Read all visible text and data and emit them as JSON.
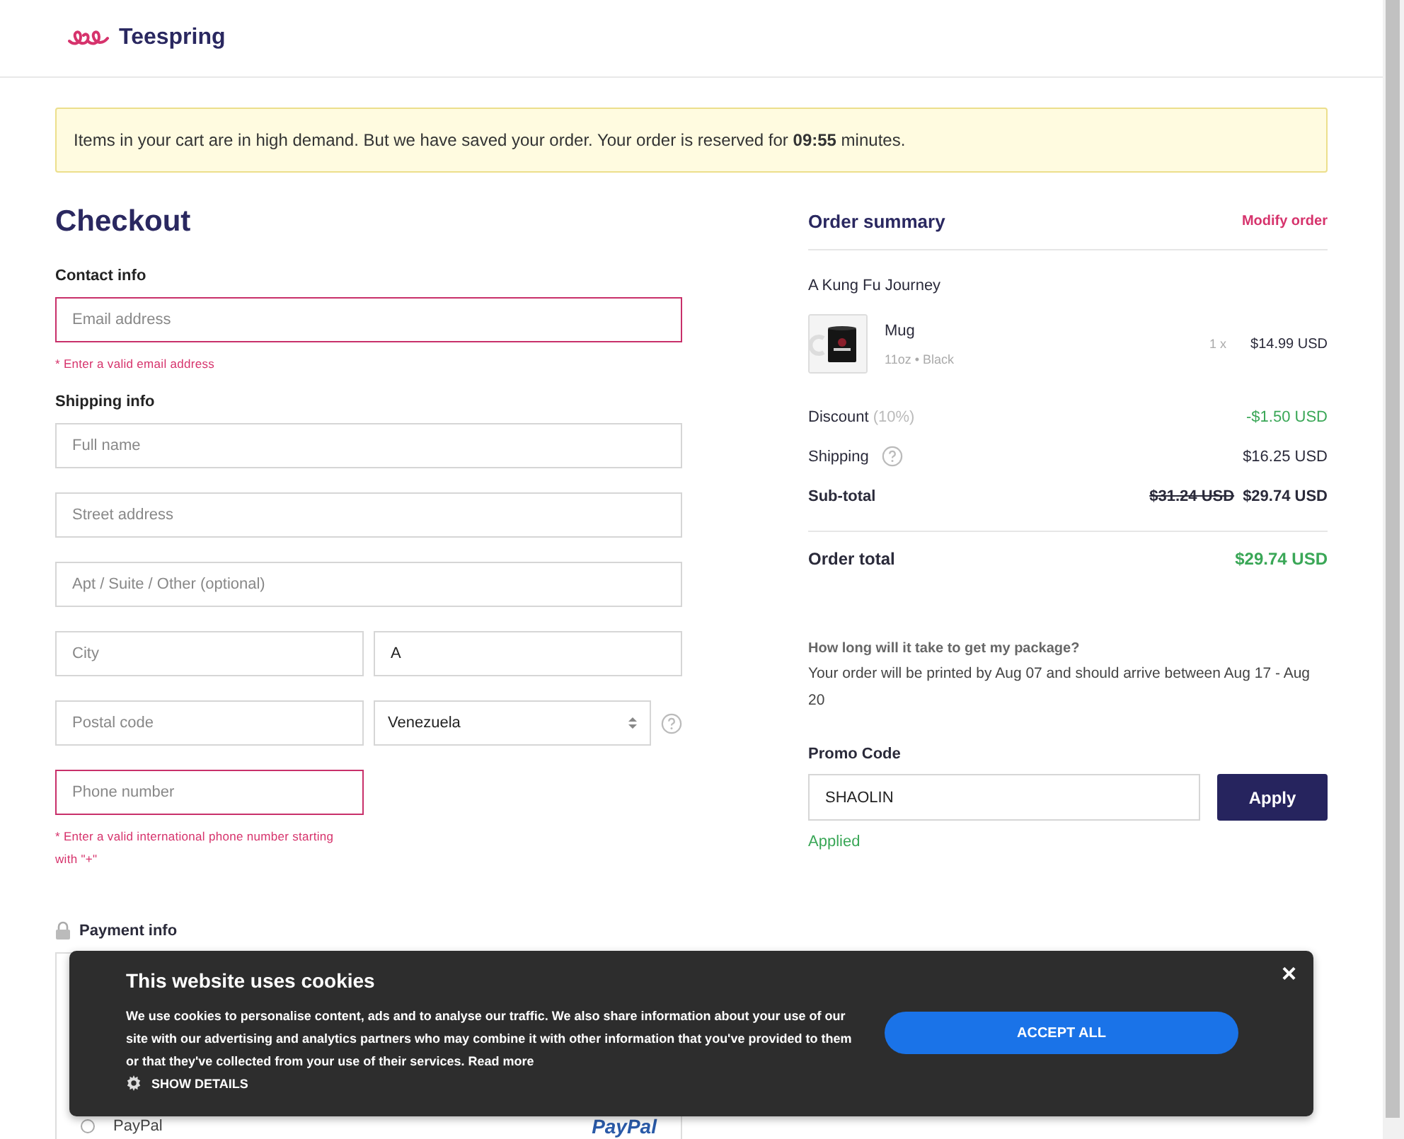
{
  "header": {
    "brand": "Teespring"
  },
  "notice": {
    "text": "Items in your cart are in high demand. But we have saved your order. Your order is reserved for **09:55** minutes."
  },
  "checkout": {
    "title": "Checkout",
    "sections": [
      {
        "heading": "Contact info",
        "rows": [
          [
            {
              "kind": "input",
              "placeholder": "Email address",
              "wide": true,
              "invalid": true,
              "error": "* Enter a valid email address"
            }
          ]
        ]
      },
      {
        "heading": "Shipping info",
        "rows": [
          [
            {
              "kind": "input",
              "placeholder": "Full name",
              "wide": true,
              "invalid": false
            }
          ],
          [
            {
              "kind": "input",
              "placeholder": "Street address",
              "wide": true,
              "invalid": false
            }
          ],
          [
            {
              "kind": "input",
              "placeholder": "Apt / Suite / Other (optional)",
              "wide": true,
              "invalid": false
            }
          ],
          [
            {
              "kind": "input",
              "placeholder": "City",
              "wide": false,
              "invalid": false
            },
            {
              "kind": "input",
              "value": "A",
              "wide": false,
              "invalid": false
            }
          ],
          [
            {
              "kind": "input",
              "placeholder": "Postal code",
              "wide": false,
              "invalid": false
            },
            {
              "kind": "select",
              "value": "Venezuela",
              "wide": false,
              "invalid": false,
              "help": true
            }
          ],
          [
            {
              "kind": "input",
              "placeholder": "Phone number",
              "wide": false,
              "invalid": true,
              "error": "* Enter a valid international phone number starting with \"+\""
            }
          ]
        ]
      }
    ]
  },
  "payment": {
    "heading": "Payment info",
    "options": [
      {
        "label": "PayPal",
        "logo": "PayPal",
        "selected": false
      }
    ]
  },
  "summary": {
    "title": "Order summary",
    "modify_link": "Modify order",
    "store": "A Kung Fu Journey",
    "item": {
      "kind": "picture",
      "name": "Mug",
      "variant": "11oz • Black",
      "quantity": "1 x",
      "price": "$14.99 USD"
    },
    "lines": [
      {
        "kind": "discount",
        "label": "Discount",
        "help": false,
        "note": "(10%)",
        "value": "-$1.50 USD"
      },
      {
        "kind": "plain",
        "label": "Shipping",
        "help": true,
        "value": "$16.25 USD"
      },
      {
        "kind": "subtotal",
        "label": "Sub-total",
        "help": false,
        "old_value": "$31.24 USD",
        "value": "$29.74 USD"
      }
    ],
    "total": {
      "label": "Order total",
      "value": "$29.74 USD"
    },
    "delivery": {
      "question": "How long will it take to get my package?",
      "answer": "Your order will be printed by Aug 07 and should arrive between Aug 17 - Aug 20"
    },
    "promo": {
      "label": "Promo Code",
      "value": "SHAOLIN",
      "button": "Apply",
      "status": "Applied"
    }
  },
  "cookie_banner": {
    "title": "This website uses cookies",
    "text": "We use cookies to personalise content, ads and to analyse our traffic. We also share information about your use of our site with our advertising and analytics partners who may combine it with other information that you've provided to them or that they've collected from your use of their services.",
    "link": "Read more",
    "details": "SHOW DETAILS",
    "accept": "ACCEPT ALL",
    "close": "×"
  }
}
